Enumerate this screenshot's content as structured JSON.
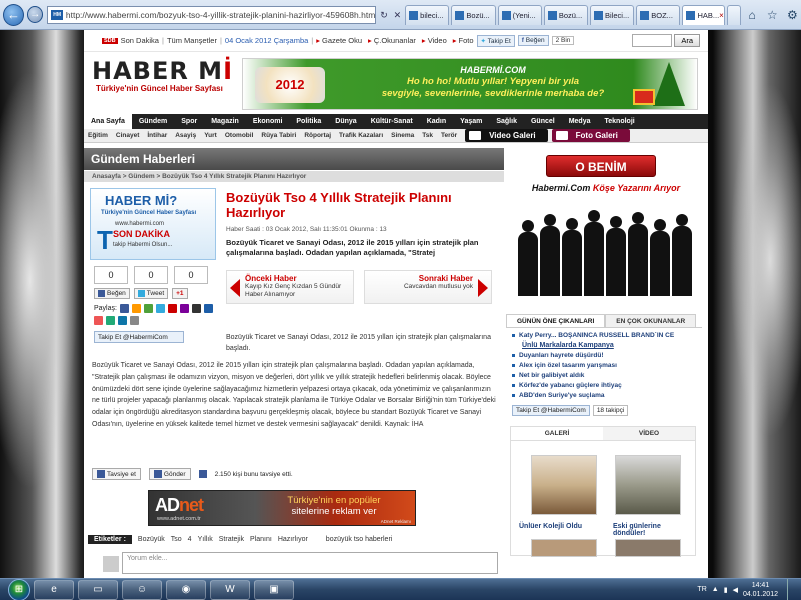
{
  "browser": {
    "back_icon": "back-arrow-icon",
    "address": "http://www.habermi.com/bozyuk-tso-4-yillik-stratejik-planini-hazirliyor-459608h.htm",
    "tabs": [
      {
        "label": "bileci...",
        "active": false
      },
      {
        "label": "Bozü...",
        "active": false
      },
      {
        "label": "(Yeni...",
        "active": false
      },
      {
        "label": "Bozü...",
        "active": false
      },
      {
        "label": "Bileci...",
        "active": false
      },
      {
        "label": "BOZ...",
        "active": false
      },
      {
        "label": "HAB...",
        "active": true
      }
    ]
  },
  "topbar": {
    "sd_badge": "SDB",
    "son_dakika": "Son Dakika",
    "tum_mansetler": "Tüm Manşetler",
    "date": "04 Ocak 2012 Çarşamba",
    "gazete": "Gazete Oku",
    "okunanlar": "Ç.Okunanlar",
    "video": "Video",
    "foto": "Foto",
    "takip": "Takip Et",
    "begen": "Beğen",
    "count": "2 Bin",
    "search_button": "Ara"
  },
  "logo": {
    "main_a": "HABER M",
    "main_b": "İ",
    "slogan": "Türkiye'nin Güncel Haber Sayfası"
  },
  "banner": {
    "year": "2012",
    "brand": "HABERMİ.COM",
    "line1": "Ho ho ho! Mutlu yıllar! Yepyeni bir yıla",
    "line2": "sevgiyle, sevenlerinle, sevdiklerinle merhaba de?"
  },
  "mainnav": [
    "Ana Sayfa",
    "Gündem",
    "Spor",
    "Magazin",
    "Ekonomi",
    "Politika",
    "Dünya",
    "Kültür-Sanat",
    "Kadın",
    "Yaşam",
    "Sağlık",
    "Güncel",
    "Medya",
    "Teknoloji"
  ],
  "subnav": [
    "Eğitim",
    "Cinayet",
    "İntihar",
    "Asayiş",
    "Yurt",
    "Otomobil",
    "Rüya Tabiri",
    "Röportaj",
    "Trafik Kazaları",
    "Sinema",
    "Tsk",
    "Terör"
  ],
  "gallery_buttons": {
    "video": "Video Galeri",
    "foto": "Foto Galeri"
  },
  "section": {
    "title": "Gündem Haberleri",
    "crumbs": "Anasayfa > Gündem > Bozüyük Tso 4 Yıllık Stratejik Planını Hazırlıyor"
  },
  "adbox": {
    "t1": "HABER Mİ?",
    "t2": "Türkiye'nin Güncel Haber Sayfası",
    "t3": "www.habermi.com",
    "t4": "SON DAKİKA",
    "t5": "takip Habermi Olsun...",
    "bigT": "T"
  },
  "share": {
    "counts": [
      "0",
      "0",
      "0"
    ],
    "begen": "Beğen",
    "tweet": "Tweet",
    "plus": "+1",
    "paylas": "Paylaş:",
    "takip": "Takip Et @HabermiCom"
  },
  "article": {
    "headline": "Bozüyük Tso 4 Yıllık Stratejik Planını Hazırlıyor",
    "meta": "Haber Saati : 03 Ocak 2012, Salı 11:35:01     Okunma : 13",
    "lead": "Bozüyük Ticaret ve Sanayi Odası, 2012 ile 2015 yılları için stratejik plan çalışmalarına başladı. Odadan yapılan açıklamada, \"Stratej",
    "prev_h": "Önceki Haber",
    "prev_b": "Kayıp Kız Genç Kızdan 5 Gündür Haber Alınamıyor",
    "next_h": "Sonraki Haber",
    "next_b": "Cavcavdan mutlusu yok",
    "intro": "Bozüyük Ticaret ve Sanayi Odası, 2012 ile 2015 yılları için stratejik plan çalışmalarına başladı.",
    "body": "Bozüyük Ticaret ve Sanayi Odası, 2012 ile 2015 yılları için stratejik plan çalışmalarına başladı. Odadan yapılan açıklamada, \"Stratejik plan çalışması ile odamızın vizyon, misyon ve değerleri, dört yıllık ve yıllık stratejik hedefleri belirlenmiş olacak. Böylece önümüzdeki dört sene içinde üyelerine sağlayacağımız hizmetlerin yelpazesi ortaya çıkacak, oda yönetimimiz ve çalışanlarımızın ne türlü projeler yapacağı planlanmış olacak. Yapılacak stratejik planlama ile Türkiye Odalar ve Borsalar Birliği'nin tüm Türkiye'deki odalar için öngördüğü akreditasyon standardına başvuru gerçekleşmiş olacak, böylece bu standart Bozüyük Ticaret ve Sanayi Odası'nın, üyelerine en yüksek kalitede temel hizmet ve destek vermesini sağlayacak\" denildi. Kaynak: İHA",
    "tavsiye": "Tavsiye et",
    "gonder": "Gönder",
    "tavsiye_count": "2.150 kişi bunu tavsiye etti."
  },
  "adnet": {
    "logo_a": "AD",
    "logo_b": "net",
    "url": "www.adnet.com.tr",
    "line1": "Türkiye'nin en popüler",
    "line2": "sitelerine reklam ver",
    "small": "ADnet Reklamı"
  },
  "tags": {
    "label": "Etiketler :",
    "items": [
      "Bozüyük",
      "Tso",
      "4",
      "Yıllık",
      "Stratejik",
      "Planını",
      "Hazırlıyor",
      "bozüyük tso haberleri"
    ]
  },
  "comment": {
    "placeholder": "Yorum ekle..."
  },
  "right": {
    "obenim": "O BENİM",
    "kose_a": "Habermi.Com ",
    "kose_b": "Köşe Yazarını Arıyor",
    "tab1": "GÜNÜN ÖNE ÇIKANLARI",
    "tab2": "EN ÇOK OKUNANLAR",
    "news": [
      "Katy Perry... BOŞANINCA RUSSELL BRAND`IN CE",
      "Ünlü Markalarda Kampanya",
      "Duyanları hayrete düşürdü!",
      "Alex için özel tasarım yarışması",
      "Net bir galibiyet aldık",
      "Körfez'de yabancı güçlere ihtiyaç",
      "ABD'den Suriye'ye suçlama"
    ],
    "takip": "Takip Et @HabermiCom",
    "takipci": "18 takipçi",
    "gtab1": "GALERİ",
    "gtab2": "VİDEO",
    "cap1": "Ünlüer Kolejli Oldu",
    "cap2": "Eski günlerine döndüler!"
  },
  "taskbar": {
    "lang": "TR",
    "time": "14:41",
    "date": "04.01.2012"
  },
  "colors": {
    "accent": "#cc0000",
    "nav": "#222222",
    "link": "#1d3f7a"
  }
}
